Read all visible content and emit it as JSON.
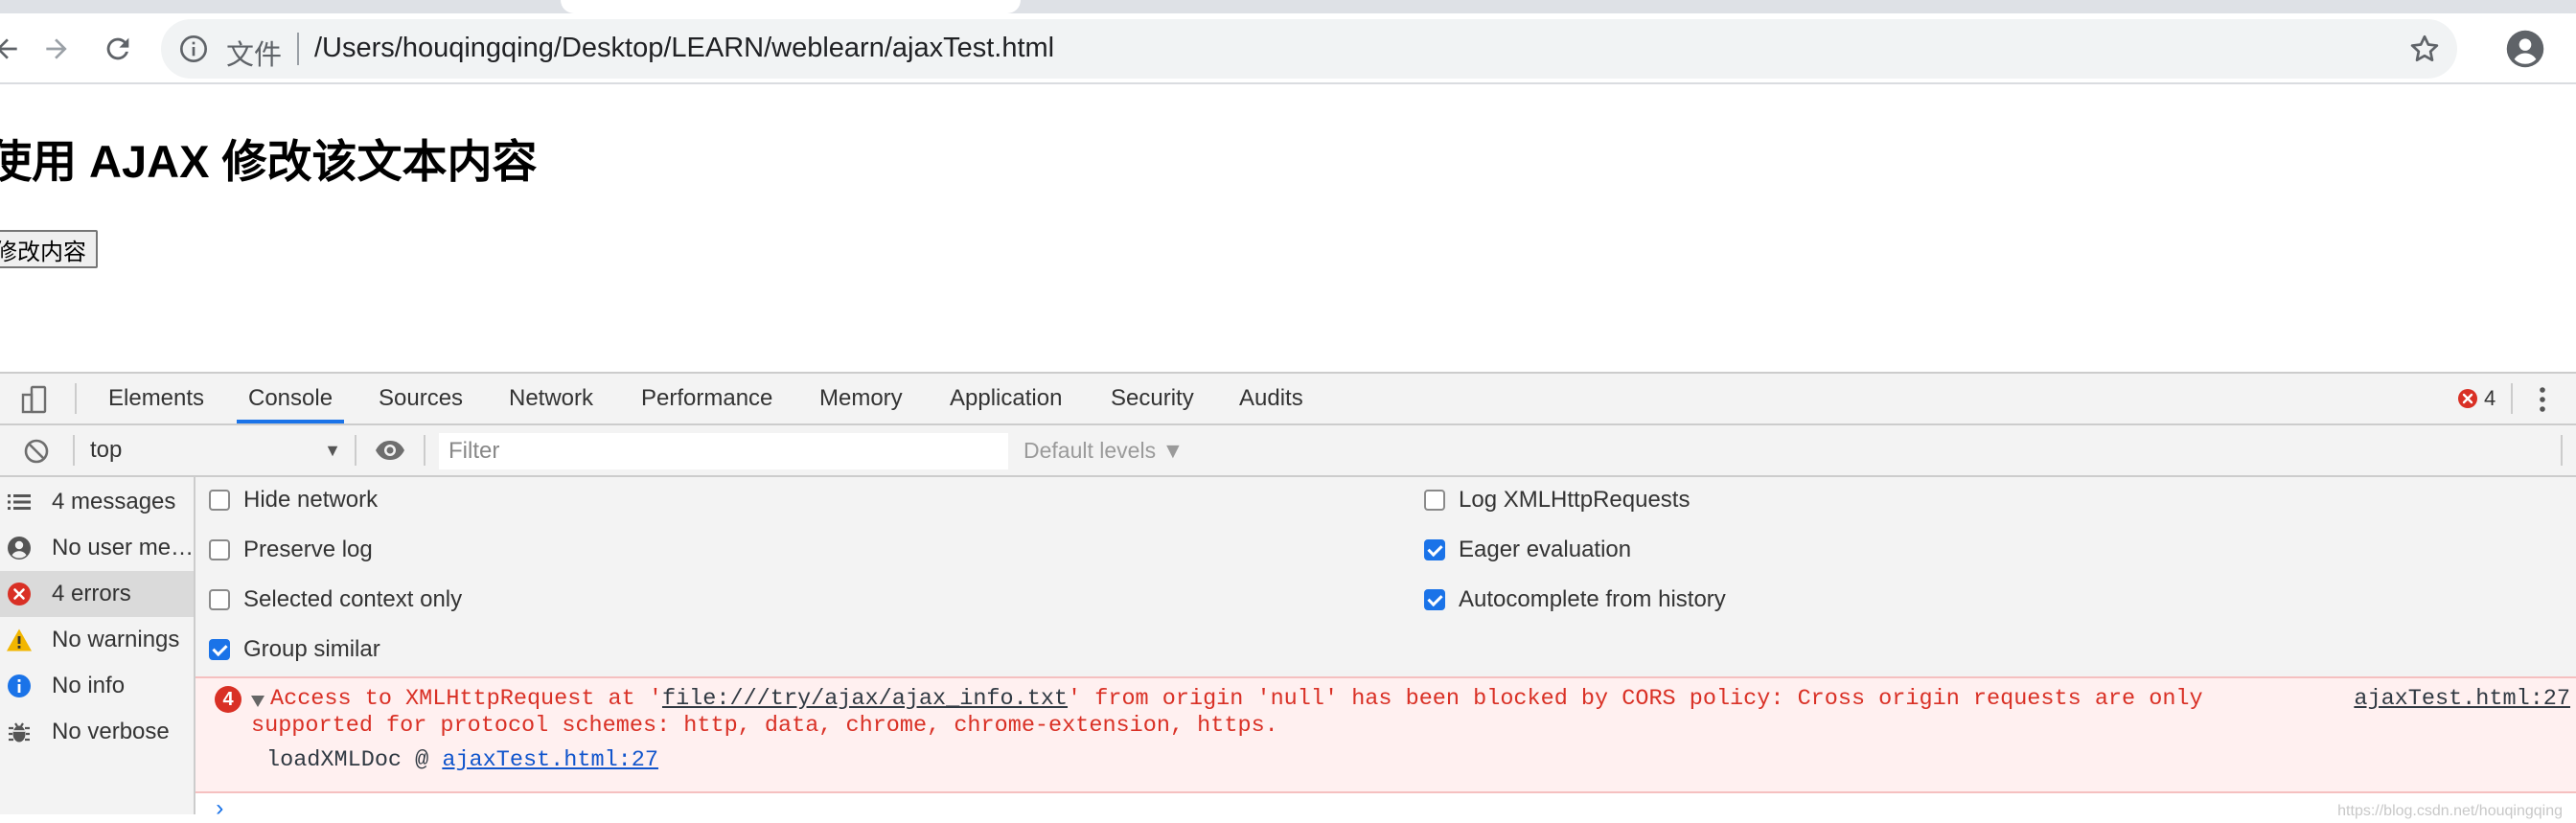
{
  "browser": {
    "scheme_label": "文件",
    "url": "/Users/houqingqing/Desktop/LEARN/weblearn/ajaxTest.html",
    "icons": {
      "back": "arrow-left-icon",
      "forward": "arrow-right-icon",
      "reload": "reload-icon",
      "info": "info-icon",
      "bookmark": "star-icon",
      "profile": "account-circle-icon"
    }
  },
  "page": {
    "heading": "使用 AJAX 修改该文本内容",
    "button_label": "修改内容"
  },
  "devtools": {
    "tabs": [
      {
        "label": "Elements",
        "active": false
      },
      {
        "label": "Console",
        "active": true
      },
      {
        "label": "Sources",
        "active": false
      },
      {
        "label": "Network",
        "active": false
      },
      {
        "label": "Performance",
        "active": false
      },
      {
        "label": "Memory",
        "active": false
      },
      {
        "label": "Application",
        "active": false
      },
      {
        "label": "Security",
        "active": false
      },
      {
        "label": "Audits",
        "active": false
      }
    ],
    "error_count": "4",
    "console_toolbar": {
      "context": "top",
      "filter_placeholder": "Filter",
      "levels_label": "Default levels ▼"
    },
    "sidebar": [
      {
        "label": "4 messages",
        "icon": "list-icon",
        "selected": false
      },
      {
        "label": "No user me…",
        "icon": "user-icon",
        "selected": false
      },
      {
        "label": "4 errors",
        "icon": "error-icon",
        "selected": true
      },
      {
        "label": "No warnings",
        "icon": "warning-icon",
        "selected": false
      },
      {
        "label": "No info",
        "icon": "info-icon",
        "selected": false
      },
      {
        "label": "No verbose",
        "icon": "bug-icon",
        "selected": false
      }
    ],
    "settings": {
      "hide_network": {
        "label": "Hide network",
        "checked": false
      },
      "preserve_log": {
        "label": "Preserve log",
        "checked": false
      },
      "selected_context_only": {
        "label": "Selected context only",
        "checked": false
      },
      "group_similar": {
        "label": "Group similar",
        "checked": true
      },
      "log_xhr": {
        "label": "Log XMLHttpRequests",
        "checked": false
      },
      "eager_evaluation": {
        "label": "Eager evaluation",
        "checked": true
      },
      "autocomplete_history": {
        "label": "Autocomplete from history",
        "checked": true
      }
    },
    "error_message": {
      "repeat_count": "4",
      "prefix": "Access to XMLHttpRequest at '",
      "link": "file:///try/ajax/ajax_info.txt",
      "suffix": "' from origin 'null' has been blocked by CORS policy: Cross origin requests are only",
      "line2": "supported for protocol schemes: http, data, chrome, chrome-extension, https.",
      "source": "ajaxTest.html:27",
      "stack_fn": "loadXMLDoc @ ",
      "stack_link": "ajaxTest.html:27"
    },
    "prompt": "›",
    "watermark": "https://blog.csdn.net/houqingqing"
  },
  "colors": {
    "accent": "#1a73e8",
    "error_red": "#d93025",
    "error_bg": "#fff0f0",
    "devtools_bg": "#f3f3f3"
  }
}
